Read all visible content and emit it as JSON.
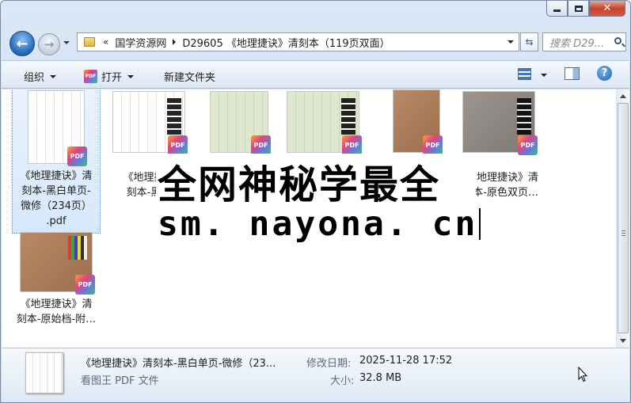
{
  "address": {
    "chevron": "«",
    "segments": [
      "国学资源网",
      "D29605 《地理捷诀》清刻本（119页双面）"
    ]
  },
  "search": {
    "placeholder": "搜索 D29..."
  },
  "toolbar": {
    "organize": "组织",
    "open": "打开",
    "open_icon": "PDF",
    "new_folder": "新建文件夹"
  },
  "files": [
    {
      "label": "《地理捷诀》清刻本-黑白单页-微修（234页）.pdf",
      "thumb": "bw",
      "selected": true
    },
    {
      "label": "《地理捷诀》清刻本-黑白",
      "thumb": "bw-color"
    },
    {
      "label": "",
      "thumb": "green"
    },
    {
      "label": "",
      "thumb": "green-color"
    },
    {
      "label": "",
      "thumb": "brown"
    },
    {
      "label": "《地理捷诀》清刻本-原色双页…",
      "visible_text": "地理捷诀》清\n本-原色双页…",
      "thumb": "gray-color"
    },
    {
      "label": "《地理捷诀》清刻本-原始档-附…",
      "thumb": "brown-color"
    }
  ],
  "labels_visible": {
    "item1": [
      "《地理捷诀》清",
      "刻本-黑白单页-",
      "微修（234页）",
      ".pdf"
    ],
    "item2": [
      "《地理捷诀",
      "刻本-黑白"
    ],
    "item6": [
      "地理捷诀》清",
      "本-原色双页…"
    ],
    "item7": [
      "《地理捷诀》清",
      "刻本-原始档-附…"
    ]
  },
  "watermark": {
    "line1": "全网神秘学最全",
    "line2": "sm. nayona. cn"
  },
  "details": {
    "name": "《地理捷诀》清刻本-黑白单页-微修（23...",
    "type": "看图王 PDF 文件",
    "modified_key": "修改日期:",
    "modified_val": "2025-11-28 17:52",
    "size_key": "大小:",
    "size_val": "32.8 MB"
  },
  "badge_text": "PDF",
  "colors": {
    "accent": "#2b71c0",
    "selection": "#d6e8fb",
    "close": "#c4432d"
  },
  "icons": [
    "back-arrow-icon",
    "forward-arrow-icon",
    "folder-icon",
    "refresh-icon",
    "search-icon",
    "view-icon",
    "preview-pane-icon",
    "help-icon",
    "pdf-icon"
  ]
}
